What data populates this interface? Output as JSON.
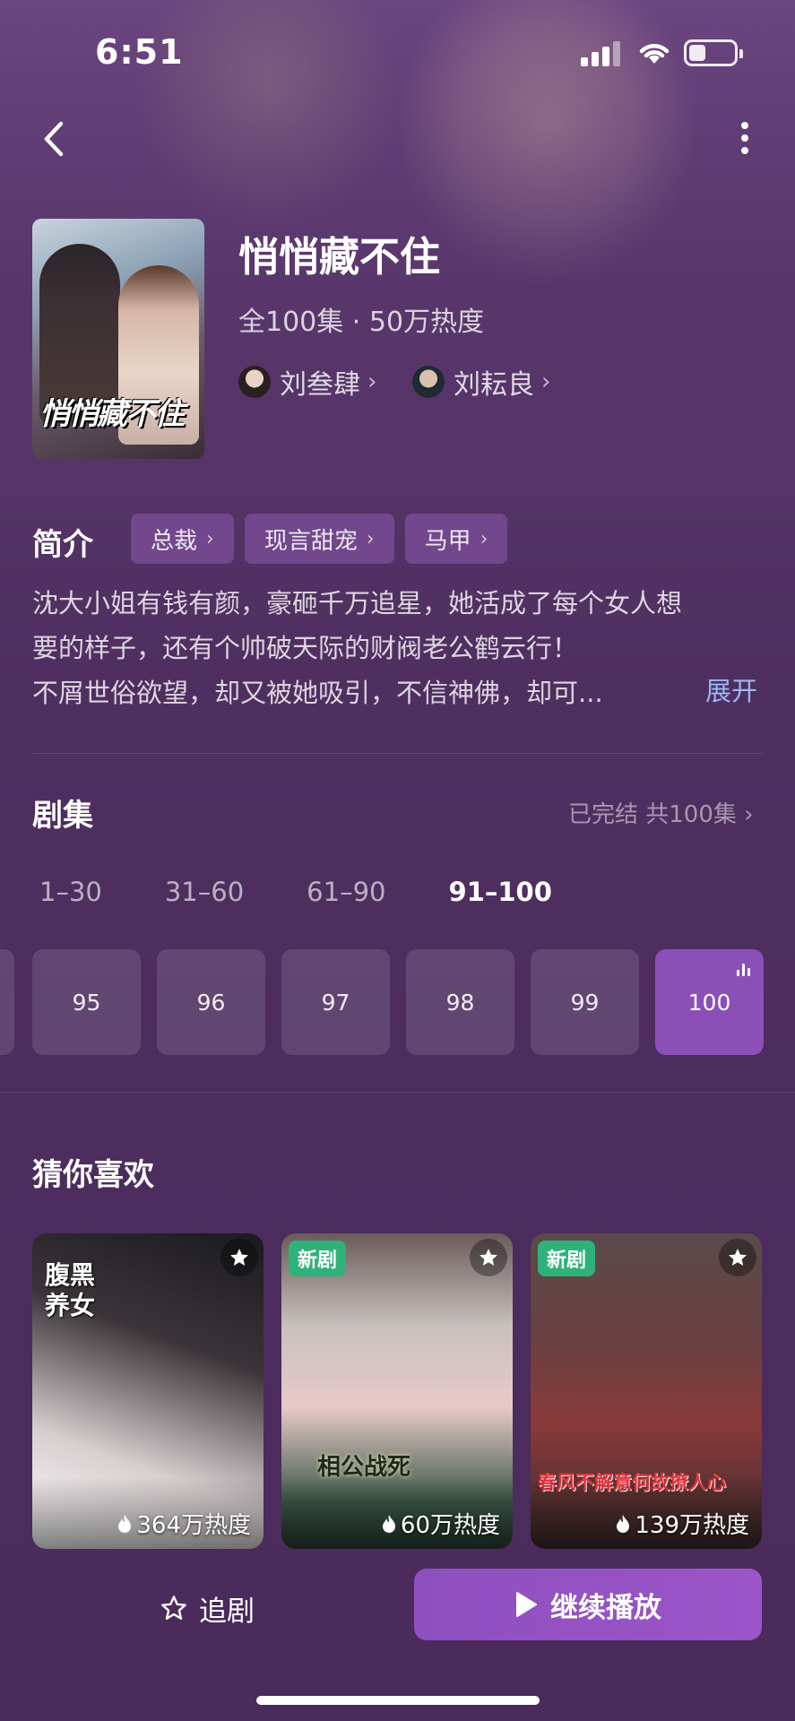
{
  "status_bar": {
    "time": "6:51"
  },
  "header": {
    "title": "悄悄藏不住",
    "meta": "全100集 · 50万热度",
    "poster_title": "悄悄藏不住",
    "actors": [
      {
        "name": "刘叁肆"
      },
      {
        "name": "刘耘良"
      }
    ]
  },
  "intro": {
    "heading": "简介",
    "tags": [
      "总裁",
      "现言甜宠",
      "马甲"
    ],
    "lines": [
      "沈大小姐有钱有颜，豪砸千万追星，她活成了每个女人想",
      "要的样子，还有个帅破天际的财阀老公鹤云行！",
      "不屑世俗欲望，却又被她吸引，不信神佛，却可..."
    ],
    "expand_label": "展开"
  },
  "episodes": {
    "heading": "剧集",
    "status": "已完结 共100集 ›",
    "ranges": [
      "1–30",
      "31–60",
      "61–90",
      "91–100"
    ],
    "active_range": "91–100",
    "items": [
      "95",
      "96",
      "97",
      "98",
      "99",
      "100"
    ],
    "current": "100"
  },
  "recommend": {
    "heading": "猜你喜欢",
    "cards": [
      {
        "badge": "",
        "heat": "364万热度",
        "poster_text": "腹黑养女"
      },
      {
        "badge": "新剧",
        "heat": "60万热度",
        "poster_text": "相公战死"
      },
      {
        "badge": "新剧",
        "heat": "139万热度",
        "poster_text": "春风不解意何故撩人心"
      }
    ]
  },
  "bottom_bar": {
    "follow_label": "追剧",
    "play_label": "继续播放"
  },
  "colors": {
    "accent": "#8b4fb8",
    "background": "#4e2c5c",
    "new_badge": "#2fb27a",
    "link": "#9ab8ef"
  },
  "icons": [
    "back-icon",
    "more-icon",
    "star-icon",
    "play-icon",
    "fire-icon",
    "equalizer-icon",
    "signal-icon",
    "wifi-icon",
    "battery-icon"
  ]
}
